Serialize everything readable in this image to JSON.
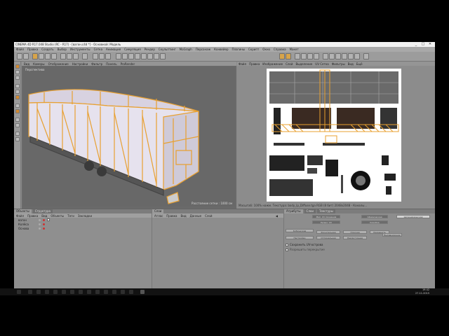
{
  "window": {
    "title": "CINEMA 4D R17.048 Studio (RC - R17) - [вагон.c4d *] - Основной: Модель",
    "controls": [
      "_",
      "□",
      "✕"
    ]
  },
  "menubar": [
    "Файл",
    "Правка",
    "Создать",
    "Выбор",
    "Инструменты",
    "Сетка",
    "Анимация",
    "Симуляция",
    "Рендер",
    "Скульптинг",
    "MoGraph",
    "Персонаж",
    "Конвейер",
    "Плагины",
    "Скрипт",
    "Окно",
    "Справка",
    "Макет"
  ],
  "viewport": {
    "menu": [
      "Вид",
      "Камеры",
      "Отображение",
      "Настройки",
      "Фильтр",
      "Панель",
      "ProRender"
    ],
    "label": "Перспектива",
    "footer": "Расстояние сетки : 1000 см"
  },
  "uv_editor": {
    "menu": [
      "Файл",
      "Правка",
      "Изображение",
      "Слой",
      "Выделение",
      "UV Сетка",
      "Фильтры",
      "Вид",
      "Ещё"
    ],
    "status": "Масштаб: 100% нажм. Текстура: body_lp_Diffuse.tga RGB (8 бит) 2048x2048 - Каналы..."
  },
  "object_manager": {
    "tabs": [
      "Объекты",
      "Структура"
    ],
    "menu": [
      "Файл",
      "Правка",
      "Вид",
      "Объекты",
      "Теги",
      "Закладки"
    ],
    "objects": [
      {
        "name": "вагон"
      },
      {
        "name": "Колёса"
      },
      {
        "name": "Основа"
      }
    ]
  },
  "mid_panel": {
    "tabs": [
      "Слои"
    ],
    "menu": [
      "Атлас",
      "Правка",
      "Вид",
      "Данные",
      "Слой"
    ]
  },
  "attributes": {
    "tabs": [
      "Атрибуты",
      "Слои",
      "Текстуры"
    ],
    "buttons": [
      "Мап. UV проекция",
      "Сферическая",
      "Цилиндрическая",
      "Релакс UV",
      "Коробка",
      "Кубическая",
      "Фронтальная",
      "Плоская",
      "Применить",
      "Настройки",
      "Оптимальная",
      "Реалистичная",
      "Выравнивание"
    ],
    "options": [
      "Сохранить UV-острова",
      "Разрешить перекрытие"
    ]
  },
  "taskbar": {
    "time": "19:42",
    "date": "27.11.2015"
  },
  "colors": {
    "accent": "#e8a030",
    "viewport_bg": "#686868",
    "panel_bg": "#8d8d8d"
  }
}
